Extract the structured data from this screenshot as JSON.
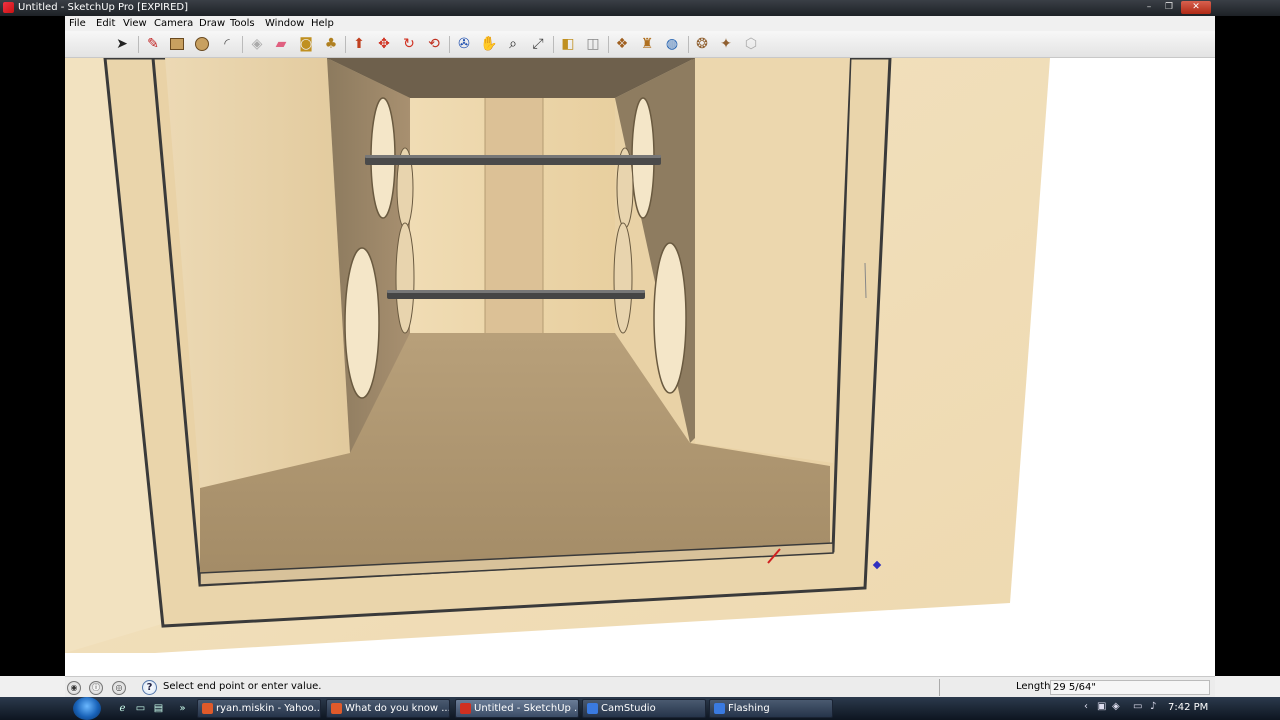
{
  "window": {
    "title": "Untitled - SketchUp Pro [EXPIRED]",
    "buttons": {
      "minimize": "–",
      "maximize": "❐",
      "close": "✕"
    }
  },
  "menu": [
    "File",
    "Edit",
    "View",
    "Camera",
    "Draw",
    "Tools",
    "Window",
    "Help"
  ],
  "toolbar": {
    "tools": [
      "select",
      "pencil",
      "rectangle",
      "circle",
      "arc",
      "eraser-box",
      "eraser",
      "tape",
      "paint",
      "push-pull",
      "move",
      "rotate",
      "offset",
      "orbit",
      "pan",
      "zoom",
      "zoom-extents",
      "section",
      "walk",
      "components",
      "sandbox",
      "warehouse",
      "shadow",
      "3d-text",
      "extensions"
    ]
  },
  "status": {
    "message": "Select end point or enter value.",
    "length_label": "Length",
    "length_value": "29 5/64\""
  },
  "taskbar": {
    "tasks": [
      {
        "label": "ryan.miskin - Yahoo...",
        "color": "#e05a2a"
      },
      {
        "label": "What do you know ...",
        "color": "#e05a2a"
      },
      {
        "label": "Untitled - SketchUp ...",
        "color": "#d03020",
        "active": true
      },
      {
        "label": "CamStudio",
        "color": "#3a7ae0"
      },
      {
        "label": "Flashing",
        "color": "#3a7ae0"
      }
    ],
    "clock": "7:42 PM"
  },
  "colors": {
    "wood_light": "#f0dcb4",
    "wood_mid": "#e2c89a",
    "wood_dark": "#a08a66",
    "edge": "#3a3a3a"
  }
}
